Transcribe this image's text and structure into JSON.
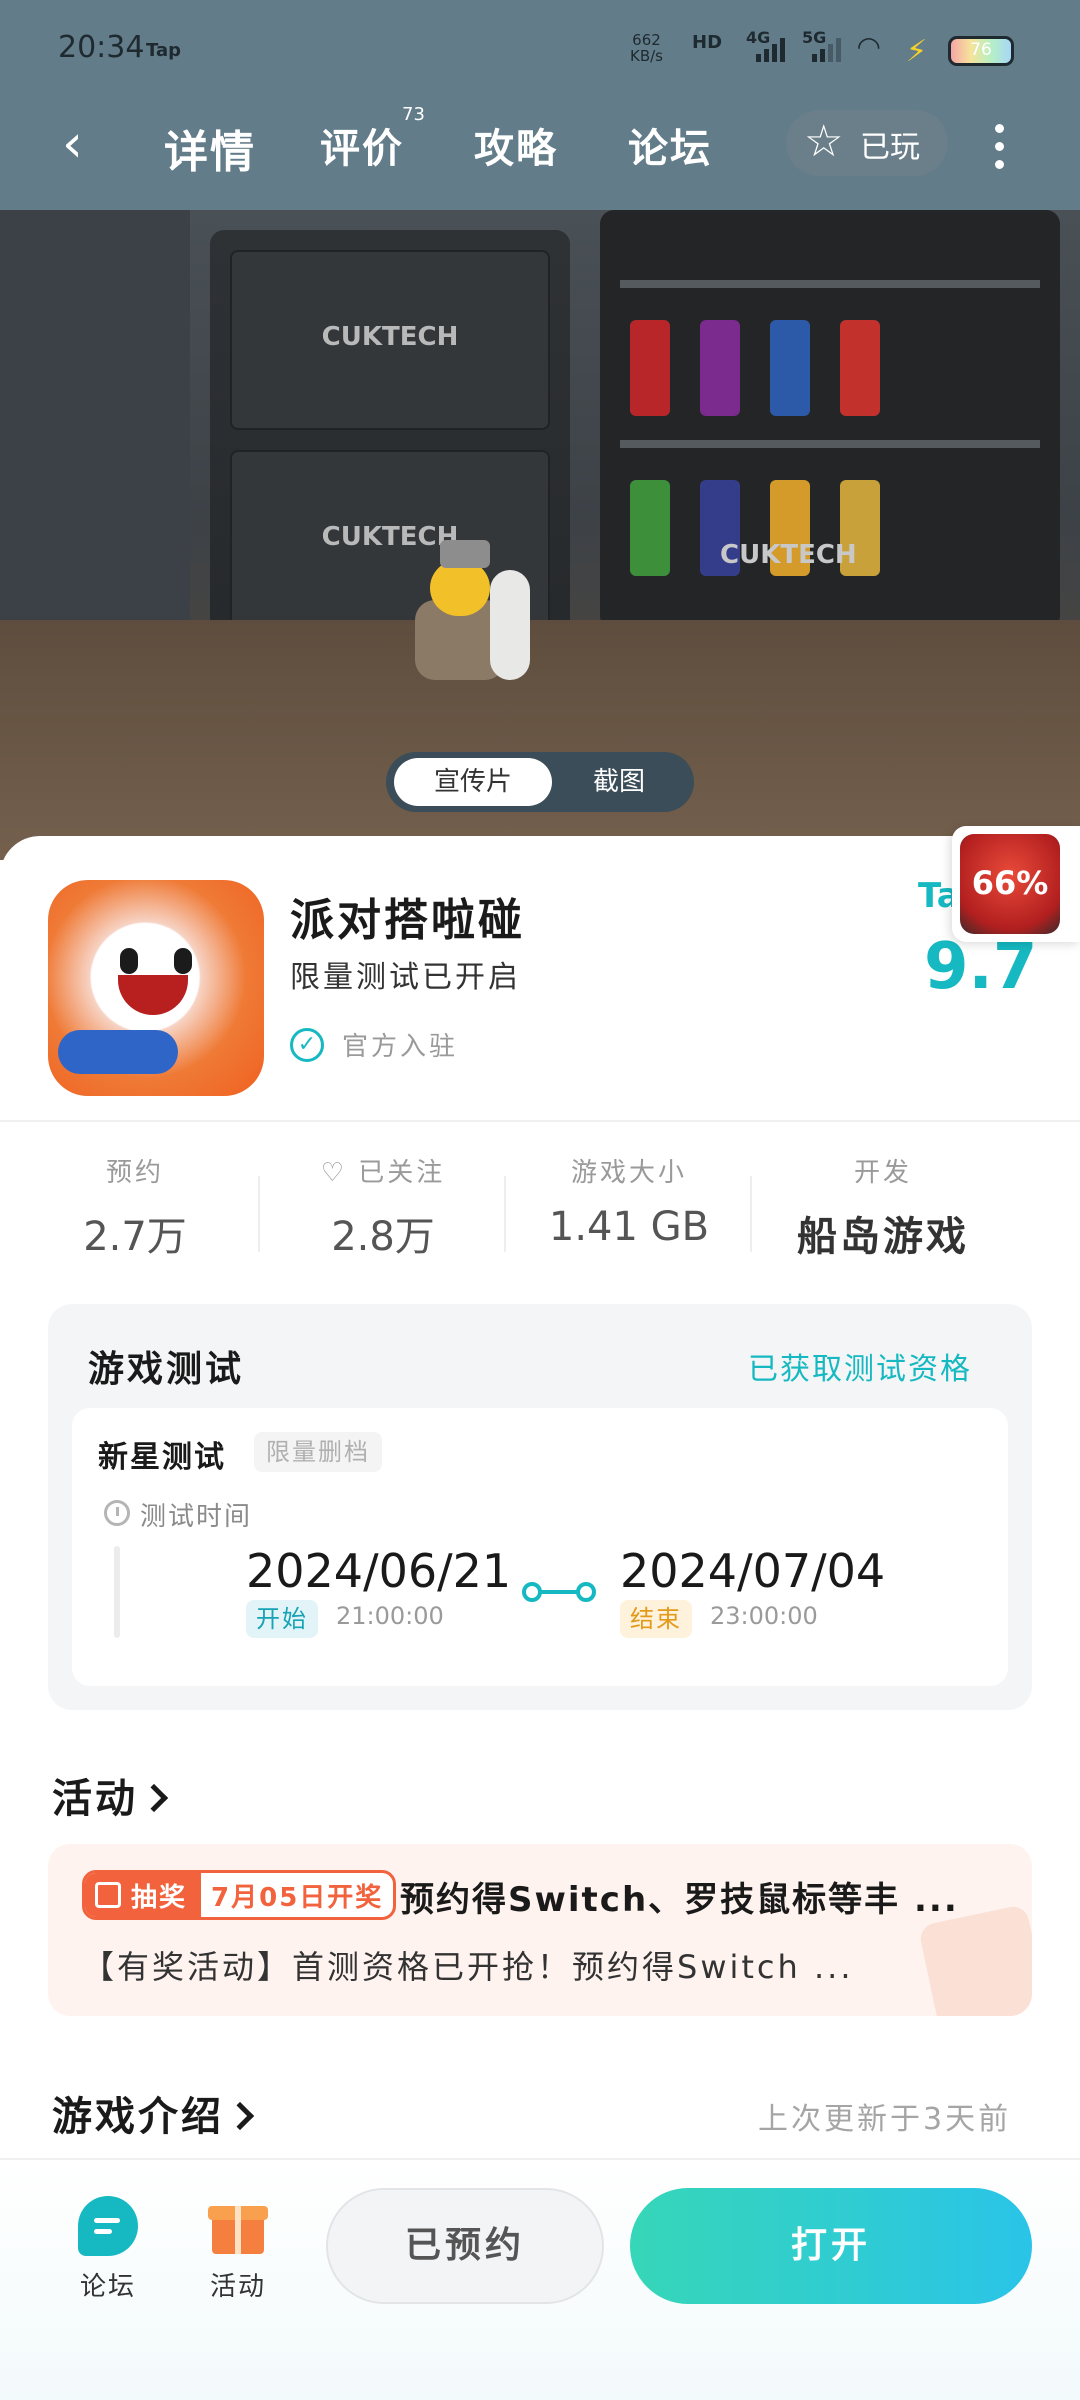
{
  "status_bar": {
    "time": "20:34",
    "app": "Tap",
    "speed": "662",
    "speed_unit": "KB/s",
    "hd": "HD",
    "net1": "4G",
    "net2": "5G",
    "battery": "76"
  },
  "nav": {
    "tabs": [
      "详情",
      "评价",
      "攻略",
      "论坛"
    ],
    "review_count": "73",
    "played_label": "已玩"
  },
  "media": {
    "tabs": [
      "宣传片",
      "截图"
    ],
    "brand_text": "CUKTECH"
  },
  "app": {
    "title": "派对搭啦碰",
    "subtitle": "限量测试已开启",
    "verified": "官方入驻",
    "score_logo": "Ta",
    "score": "9.7",
    "float_badge_pct": "66%"
  },
  "stats": [
    {
      "label": "预约",
      "value": "2.7万"
    },
    {
      "label": "已关注",
      "value": "2.8万"
    },
    {
      "label": "游戏大小",
      "value": "1.41 GB"
    },
    {
      "label": "开发",
      "value": "船岛游戏"
    }
  ],
  "test": {
    "title": "游戏测试",
    "qualification": "已获取测试资格",
    "name": "新星测试",
    "tag": "限量删档",
    "time_label": "测试时间",
    "start_date": "2024/06/21",
    "start_label": "开始",
    "start_time": "21:00:00",
    "end_date": "2024/07/04",
    "end_label": "结束",
    "end_time": "23:00:00"
  },
  "activity": {
    "section": "活动",
    "badge_left": "抽奖",
    "badge_right": "7月05日开奖",
    "headline": "预约得Switch、罗技鼠标等丰 ...",
    "body": "【有奖活动】首测资格已开抢！预约得Switch ..."
  },
  "intro": {
    "section": "游戏介绍",
    "updated": "上次更新于3天前"
  },
  "bottom": {
    "forum": "论坛",
    "activity": "活动",
    "reserved": "已预约",
    "open": "打开"
  },
  "colors": {
    "accent": "#16b9c2",
    "activity_orange": "#f2623d"
  }
}
